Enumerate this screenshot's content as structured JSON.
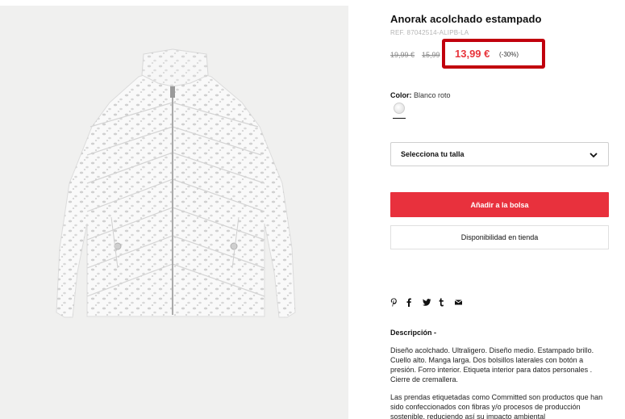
{
  "product": {
    "title": "Anorak acolchado estampado",
    "ref": "REF. 87042514-ALIPB-LA",
    "old_price_1": "19,99 €",
    "old_price_2": "15,99",
    "sale_price": "13,99 €",
    "discount": "(-30%)",
    "color_label": "Color:",
    "color_value": "Blanco roto",
    "size_placeholder": "Selecciona tu talla",
    "add_to_bag": "Añadir a la bolsa",
    "store_availability": "Disponibilidad en tienda",
    "description_title": "Descripción -",
    "description": "Diseño acolchado. Ultraligero. Diseño medio. Estampado brillo. Cuello alto. Manga larga. Dos bolsillos laterales con botón a presión. Forro interior. Etiqueta interior para datos personales . Cierre de cremallera.",
    "committed_text": "Las prendas etiquetadas como Committed son productos que han sido confeccionados con fibras y/o procesos de producción sostenible, reduciendo así su impacto ambiental"
  },
  "share_icons": [
    "pinterest-icon",
    "facebook-icon",
    "twitter-icon",
    "tumblr-icon",
    "email-icon"
  ],
  "colors": {
    "accent": "#e8313d",
    "highlight_box": "#c1000d",
    "sale": "#e8353c"
  }
}
